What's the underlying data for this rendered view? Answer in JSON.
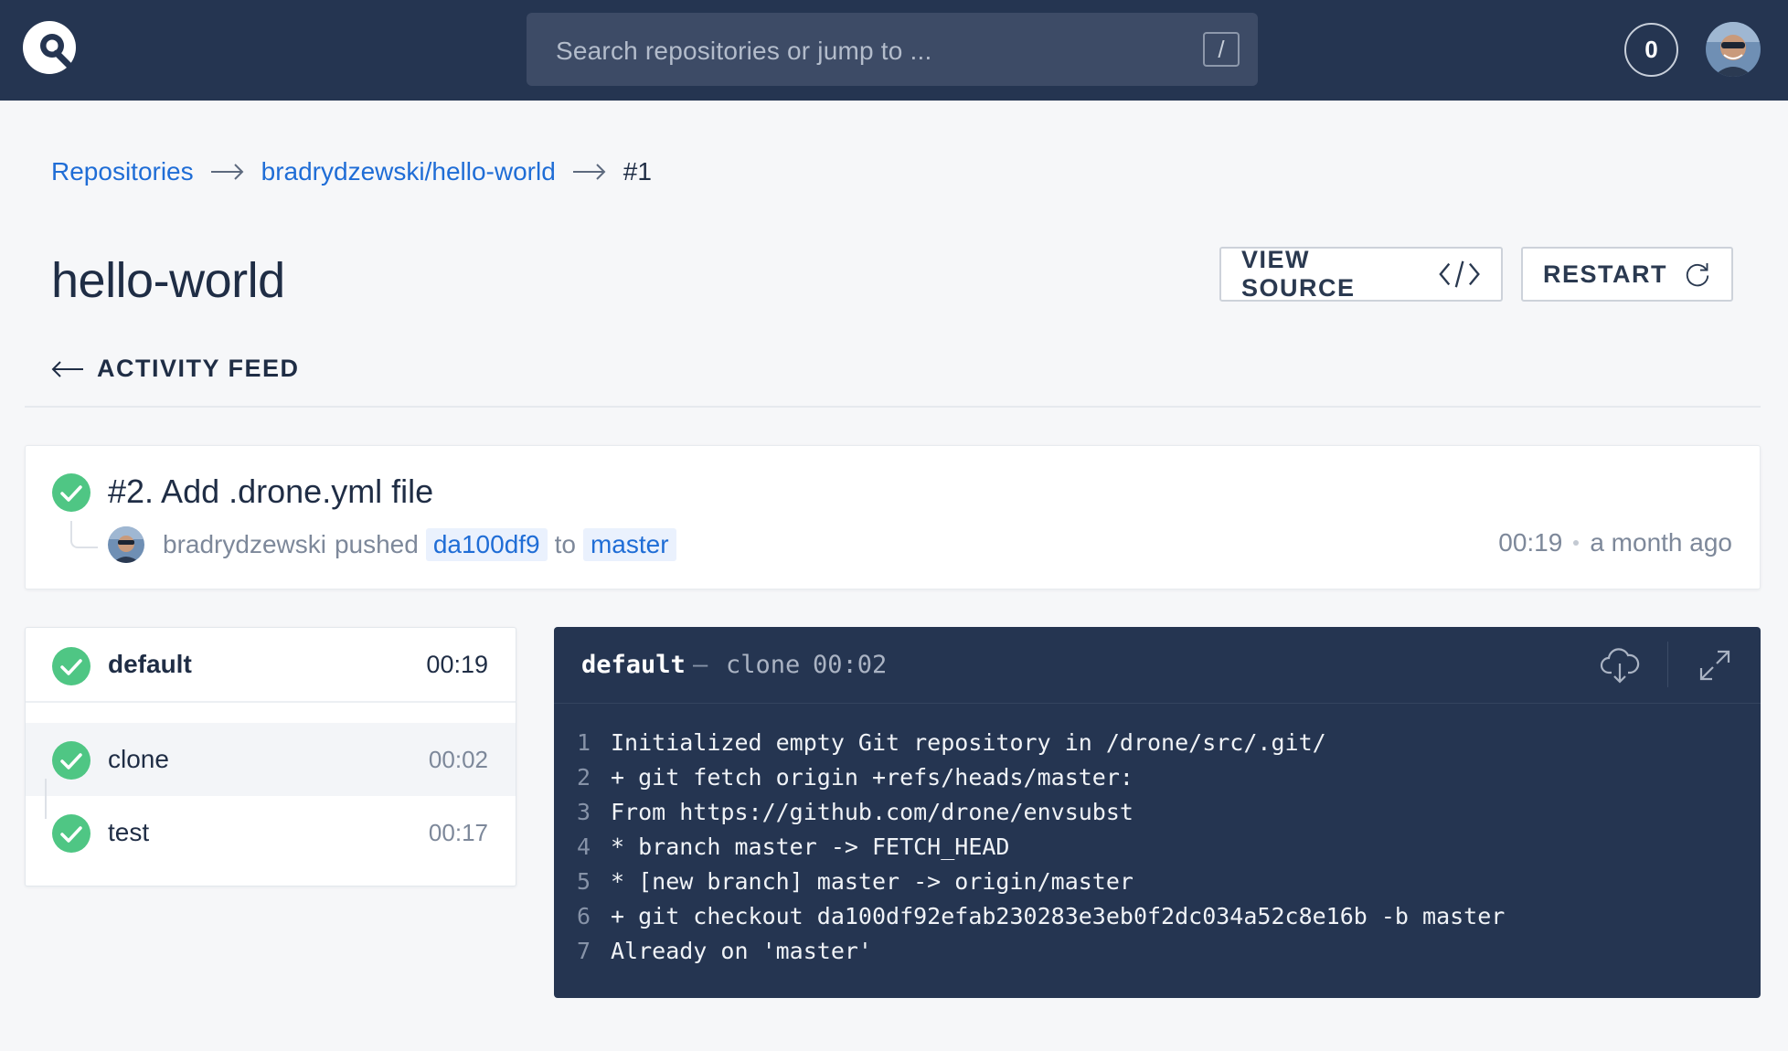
{
  "header": {
    "logo": "drone-logo-icon",
    "search": {
      "placeholder": "Search repositories or jump to ...",
      "shortcut": "/"
    },
    "notifications_count": "0",
    "user_avatar": "user-avatar"
  },
  "breadcrumb": {
    "items": [
      "Repositories",
      "bradrydzewski/hello-world",
      "#1"
    ]
  },
  "page": {
    "title": "hello-world",
    "view_source_label": "VIEW SOURCE",
    "restart_label": "RESTART",
    "back_label": "ACTIVITY FEED"
  },
  "build": {
    "title": "#2. Add .drone.yml file",
    "author": "bradrydzewski",
    "action": "pushed",
    "commit": "da100df9",
    "to_word": "to",
    "branch": "master",
    "duration": "00:19",
    "when": "a month ago",
    "status": "success"
  },
  "stages": {
    "name": "default",
    "duration": "00:19",
    "steps": [
      {
        "name": "clone",
        "duration": "00:02",
        "status": "success"
      },
      {
        "name": "test",
        "duration": "00:17",
        "status": "success"
      }
    ]
  },
  "log": {
    "stage": "default",
    "separator": "—",
    "step": "clone",
    "time": "00:02",
    "lines": [
      {
        "n": "1",
        "text": "Initialized empty Git repository in /drone/src/.git/"
      },
      {
        "n": "2",
        "text": "+ git fetch origin +refs/heads/master:"
      },
      {
        "n": "3",
        "text": "From https://github.com/drone/envsubst"
      },
      {
        "n": "4",
        "text": "* branch master -> FETCH_HEAD"
      },
      {
        "n": "5",
        "text": "* [new branch] master -> origin/master"
      },
      {
        "n": "6",
        "text": "+ git checkout da100df92efab230283e3eb0f2dc034a52c8e16b -b master"
      },
      {
        "n": "7",
        "text": "Already on 'master'"
      }
    ]
  },
  "colors": {
    "header_bg": "#253551",
    "link": "#1f6dd6",
    "success": "#4fc684",
    "log_bg": "#253551"
  }
}
